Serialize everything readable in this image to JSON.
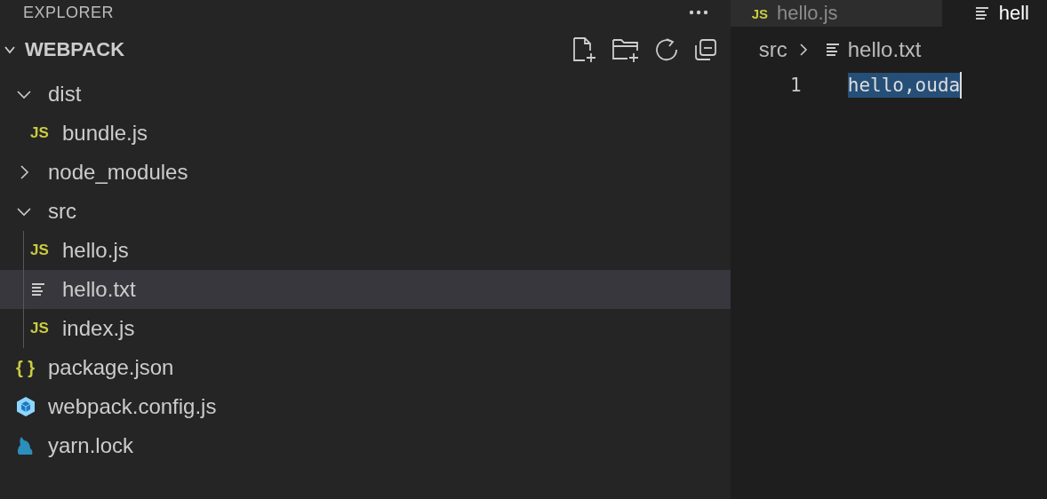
{
  "sidebar": {
    "title": "EXPLORER",
    "section": {
      "title": "WEBPACK",
      "expanded": true
    },
    "tree": [
      {
        "name": "dist",
        "kind": "folder",
        "expanded": true,
        "selected": false,
        "children": [
          {
            "name": "bundle.js",
            "kind": "js",
            "badge": "JS",
            "selected": false
          }
        ]
      },
      {
        "name": "node_modules",
        "kind": "folder",
        "expanded": false,
        "selected": false
      },
      {
        "name": "src",
        "kind": "folder",
        "expanded": true,
        "selected": false,
        "children": [
          {
            "name": "hello.js",
            "kind": "js",
            "badge": "JS",
            "selected": false
          },
          {
            "name": "hello.txt",
            "kind": "txt",
            "selected": true
          },
          {
            "name": "index.js",
            "kind": "js",
            "badge": "JS",
            "selected": false
          }
        ]
      },
      {
        "name": "package.json",
        "kind": "json",
        "badge": "{ }",
        "selected": false
      },
      {
        "name": "webpack.config.js",
        "kind": "webpack",
        "selected": false
      },
      {
        "name": "yarn.lock",
        "kind": "yarn",
        "selected": false
      }
    ]
  },
  "editor": {
    "tabs": [
      {
        "label": "hello.js",
        "kind": "js",
        "badge": "JS",
        "selected": false
      },
      {
        "label": "hell",
        "kind": "txt",
        "selected": true
      }
    ],
    "breadcrumb": [
      {
        "label": "src",
        "kind": "folder"
      },
      {
        "label": "hello.txt",
        "kind": "txt"
      }
    ],
    "lines": [
      {
        "number": "1",
        "text": "hello,ouda",
        "selected": true
      }
    ]
  }
}
